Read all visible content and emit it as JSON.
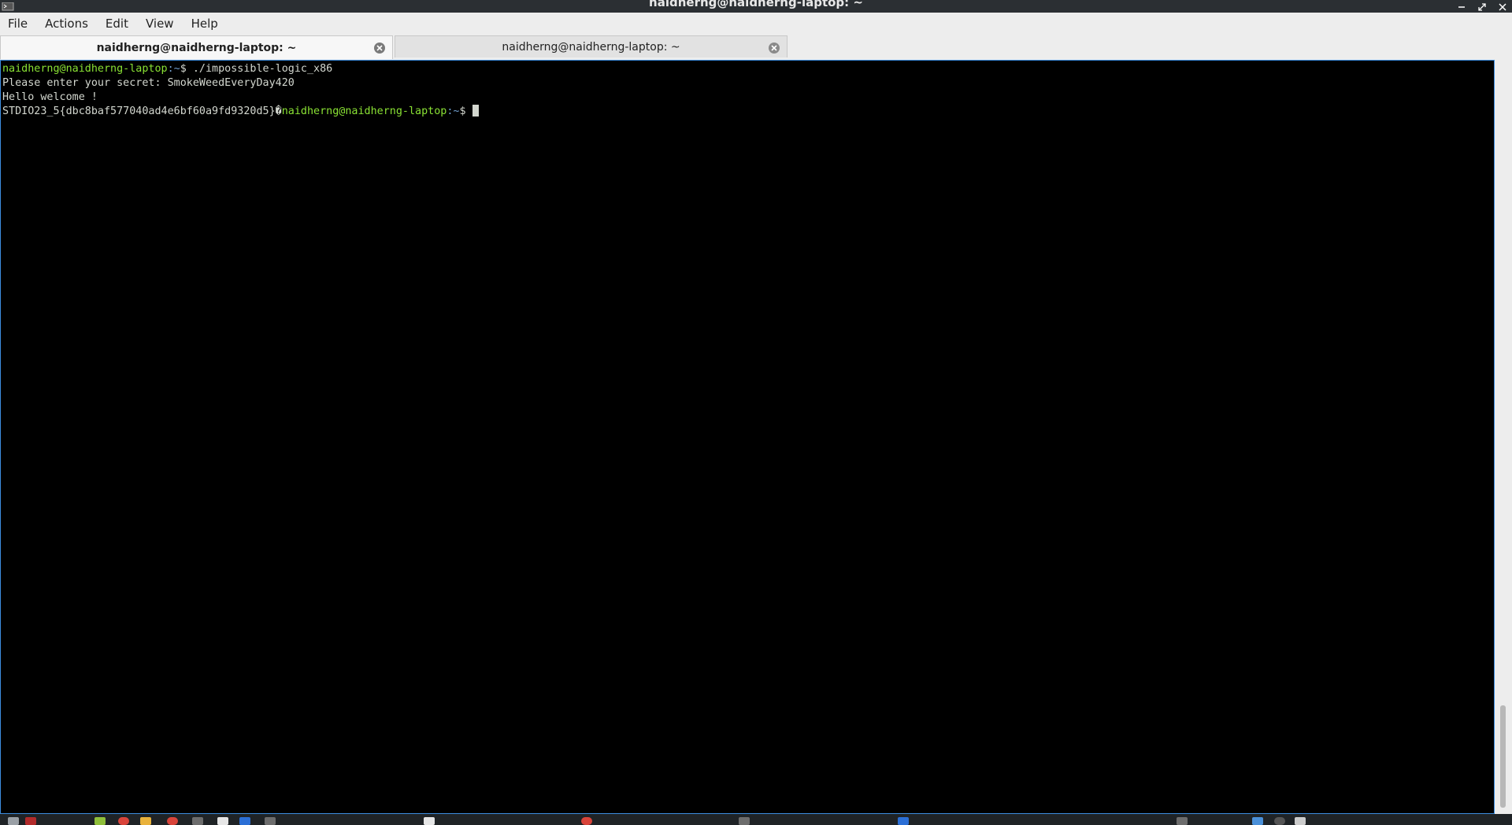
{
  "window": {
    "title": "naidherng@naidherng-laptop: ~"
  },
  "menubar": {
    "items": [
      {
        "label": "File"
      },
      {
        "label": "Actions"
      },
      {
        "label": "Edit"
      },
      {
        "label": "View"
      },
      {
        "label": "Help"
      }
    ]
  },
  "tabs": [
    {
      "label": "naidherng@naidherng-laptop: ~",
      "active": true
    },
    {
      "label": "naidherng@naidherng-laptop: ~",
      "active": false
    }
  ],
  "terminal": {
    "prompt_user": "naidherng@naidherng-laptop",
    "prompt_path": ":~",
    "prompt_dollar": "$",
    "line1_cmd": " ./impossible-logic_x86",
    "line2": "Please enter your secret: SmokeWeedEveryDay420",
    "line3": "Hello welcome !",
    "line4_output": "STDIO23_5{dbc8baf577040ad4e6bf60a9fd9320d5}�"
  },
  "colors": {
    "prompt_user": "#8ae234",
    "prompt_path": "#729fcf",
    "terminal_bg": "#000000",
    "terminal_fg": "#d3d7cf",
    "focus_border": "#3d8ee0"
  }
}
